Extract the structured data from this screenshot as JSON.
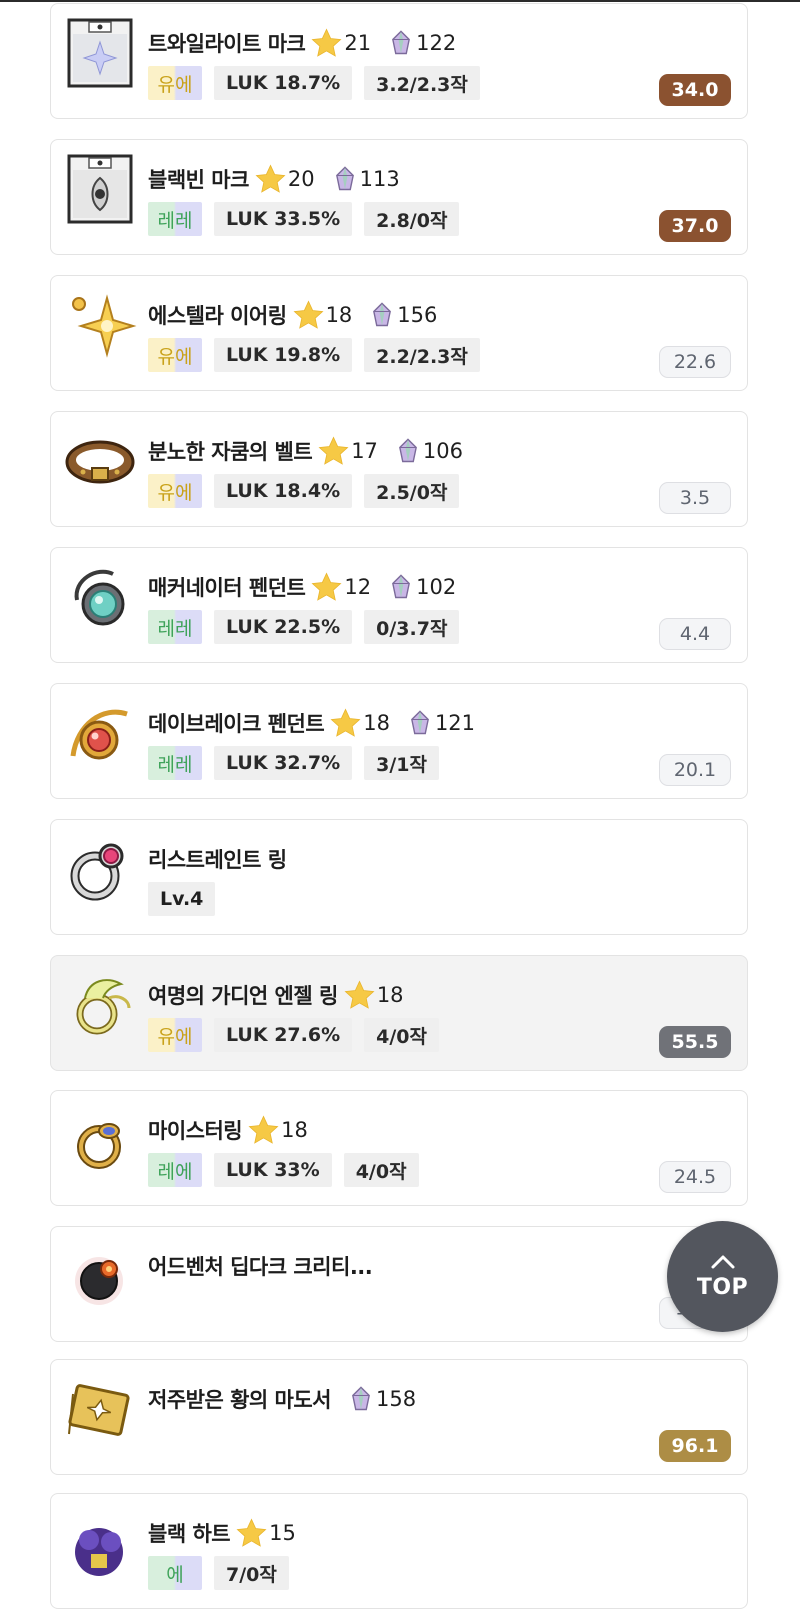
{
  "colors": {
    "score_brown": "#8b5230",
    "score_gold": "#ad8d45",
    "score_dark": "#707278",
    "score_light": "#f4f5f7",
    "potential_unique": "#c9a21a",
    "potential_epic": "#7a6fd6",
    "potential_legendary": "#3fa35a",
    "top_button": "#53565e"
  },
  "top_button": {
    "label": "TOP",
    "icon": "chevron-up-icon"
  },
  "items": [
    {
      "name": "트와일라이트 마크",
      "icon": "twilight-mark-icon",
      "stars": "21",
      "gem": "122",
      "potential": "유에",
      "potential_type": "yu",
      "stat": "LUK 18.7%",
      "scroll": "3.2/2.3작",
      "score": "34.0",
      "score_style": "brown",
      "highlight": false
    },
    {
      "name": "블랙빈 마크",
      "icon": "blackbean-mark-icon",
      "stars": "20",
      "gem": "113",
      "potential": "레레",
      "potential_type": "le",
      "stat": "LUK 33.5%",
      "scroll": "2.8/0작",
      "score": "37.0",
      "score_style": "brown",
      "highlight": false
    },
    {
      "name": "에스텔라 이어링",
      "icon": "estella-earring-icon",
      "stars": "18",
      "gem": "156",
      "potential": "유에",
      "potential_type": "yu",
      "stat": "LUK 19.8%",
      "scroll": "2.2/2.3작",
      "score": "22.6",
      "score_style": "light",
      "highlight": false
    },
    {
      "name": "분노한 자쿰의 벨트",
      "icon": "zakum-belt-icon",
      "stars": "17",
      "gem": "106",
      "potential": "유에",
      "potential_type": "yu",
      "stat": "LUK 18.4%",
      "scroll": "2.5/0작",
      "score": "3.5",
      "score_style": "light",
      "highlight": false
    },
    {
      "name": "매커네이터 펜던트",
      "icon": "mechanator-pendant-icon",
      "stars": "12",
      "gem": "102",
      "potential": "레레",
      "potential_type": "le",
      "stat": "LUK 22.5%",
      "scroll": "0/3.7작",
      "score": "4.4",
      "score_style": "light",
      "highlight": false
    },
    {
      "name": "데이브레이크 펜던트",
      "icon": "daybreak-pendant-icon",
      "stars": "18",
      "gem": "121",
      "potential": "레레",
      "potential_type": "le",
      "stat": "LUK 32.7%",
      "scroll": "3/1작",
      "score": "20.1",
      "score_style": "light",
      "highlight": false
    },
    {
      "name": "리스트레인트 링",
      "icon": "restraint-ring-icon",
      "stars": "",
      "gem": "",
      "potential": "Lv.4",
      "potential_type": "lv",
      "stat": "",
      "scroll": "",
      "score": "",
      "score_style": "",
      "highlight": false
    },
    {
      "name": "여명의 가디언 엔젤 링",
      "icon": "guardian-angel-ring-icon",
      "stars": "18",
      "gem": "",
      "potential": "유에",
      "potential_type": "yu",
      "stat": "LUK 27.6%",
      "scroll": "4/0작",
      "score": "55.5",
      "score_style": "dark",
      "highlight": true
    },
    {
      "name": "마이스터링",
      "icon": "meister-ring-icon",
      "stars": "18",
      "gem": "",
      "potential": "레에",
      "potential_type": "le",
      "stat": "LUK 33%",
      "scroll": "4/0작",
      "score": "24.5",
      "score_style": "light",
      "highlight": false
    },
    {
      "name": "어드벤처 딥다크 크리티...",
      "icon": "deep-dark-critical-ring-icon",
      "stars": "",
      "gem": "",
      "potential": "",
      "potential_type": "",
      "stat": "",
      "scroll": "",
      "score": "-4.3",
      "score_style": "light",
      "highlight": false
    },
    {
      "name": "저주받은 황의 마도서",
      "icon": "cursed-yellow-spellbook-icon",
      "stars": "",
      "gem": "158",
      "potential": "",
      "potential_type": "",
      "stat": "",
      "scroll": "",
      "score": "96.1",
      "score_style": "gold",
      "highlight": false
    },
    {
      "name": "블랙 하트",
      "icon": "black-heart-icon",
      "stars": "15",
      "gem": "",
      "potential": "에",
      "potential_type": "le",
      "stat": "",
      "scroll": "7/0작",
      "score": "",
      "score_style": "brown",
      "highlight": false
    }
  ]
}
